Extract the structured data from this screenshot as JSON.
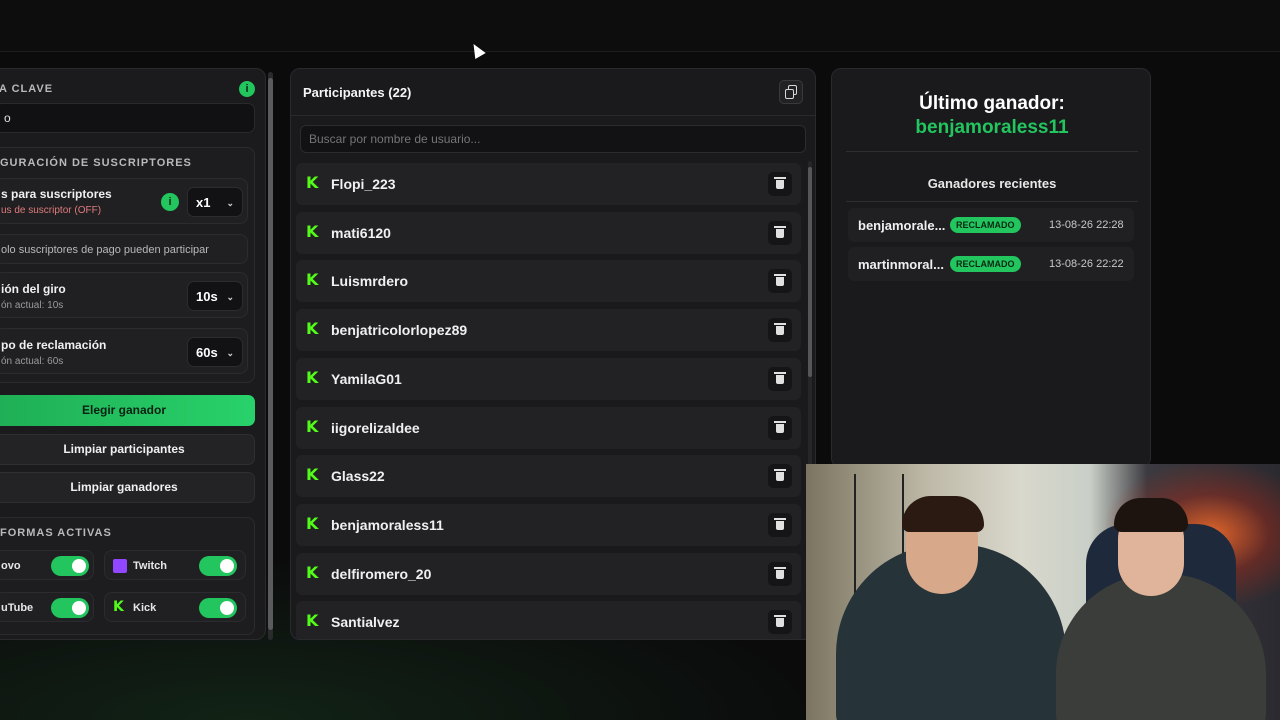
{
  "left_panel": {
    "key_section_title": "A CLAVE",
    "key_value": "o",
    "sub_config_title": "GURACIÓN DE SUSCRIPTORES",
    "sub_bonus_label": "s para suscriptores",
    "sub_bonus_sub": "us de suscriptor (OFF)",
    "multiplier_value": "x1",
    "paid_only_text": "olo suscriptores de pago pueden participar",
    "spin_label": "ión del giro",
    "spin_sub": "ón actual: 10s",
    "spin_value": "10s",
    "claim_label": "po de reclamación",
    "claim_sub": "ón actual: 60s",
    "claim_value": "60s",
    "btn_pick_winner": "Elegir ganador",
    "btn_clear_participants": "Limpiar participantes",
    "btn_clear_winners": "Limpiar ganadores",
    "platforms_title": "FORMAS ACTIVAS",
    "platforms": [
      {
        "label": "ovo",
        "on": true
      },
      {
        "label": "Twitch",
        "on": true
      },
      {
        "label": "uTube",
        "on": true
      },
      {
        "label": "Kick",
        "on": true
      }
    ],
    "info_glyph": "i"
  },
  "participants": {
    "title": "Participantes (22)",
    "search_placeholder": "Buscar por nombre de usuario...",
    "platform_glyph": "K",
    "list": [
      "Flopi_223",
      "mati6120",
      "Luismrdero",
      "benjatricolorlopez89",
      "YamilaG01",
      "iigorelizaldee",
      "Glass22",
      "benjamoraless11",
      "delfiromero_20",
      "Santialvez"
    ]
  },
  "winner_panel": {
    "title": "Último ganador:",
    "winner_name": "benjamoraless11",
    "recent_title": "Ganadores recientes",
    "recent": [
      {
        "name": "benjamorale...",
        "badge": "RECLAMADO",
        "date": "13-08-26 22:28"
      },
      {
        "name": "martinmoral...",
        "badge": "RECLAMADO",
        "date": "13-08-26 22:22"
      }
    ]
  },
  "colors": {
    "accent_green": "#22c55e",
    "kick_green": "#53fc18",
    "twitch_purple": "#9146ff"
  }
}
